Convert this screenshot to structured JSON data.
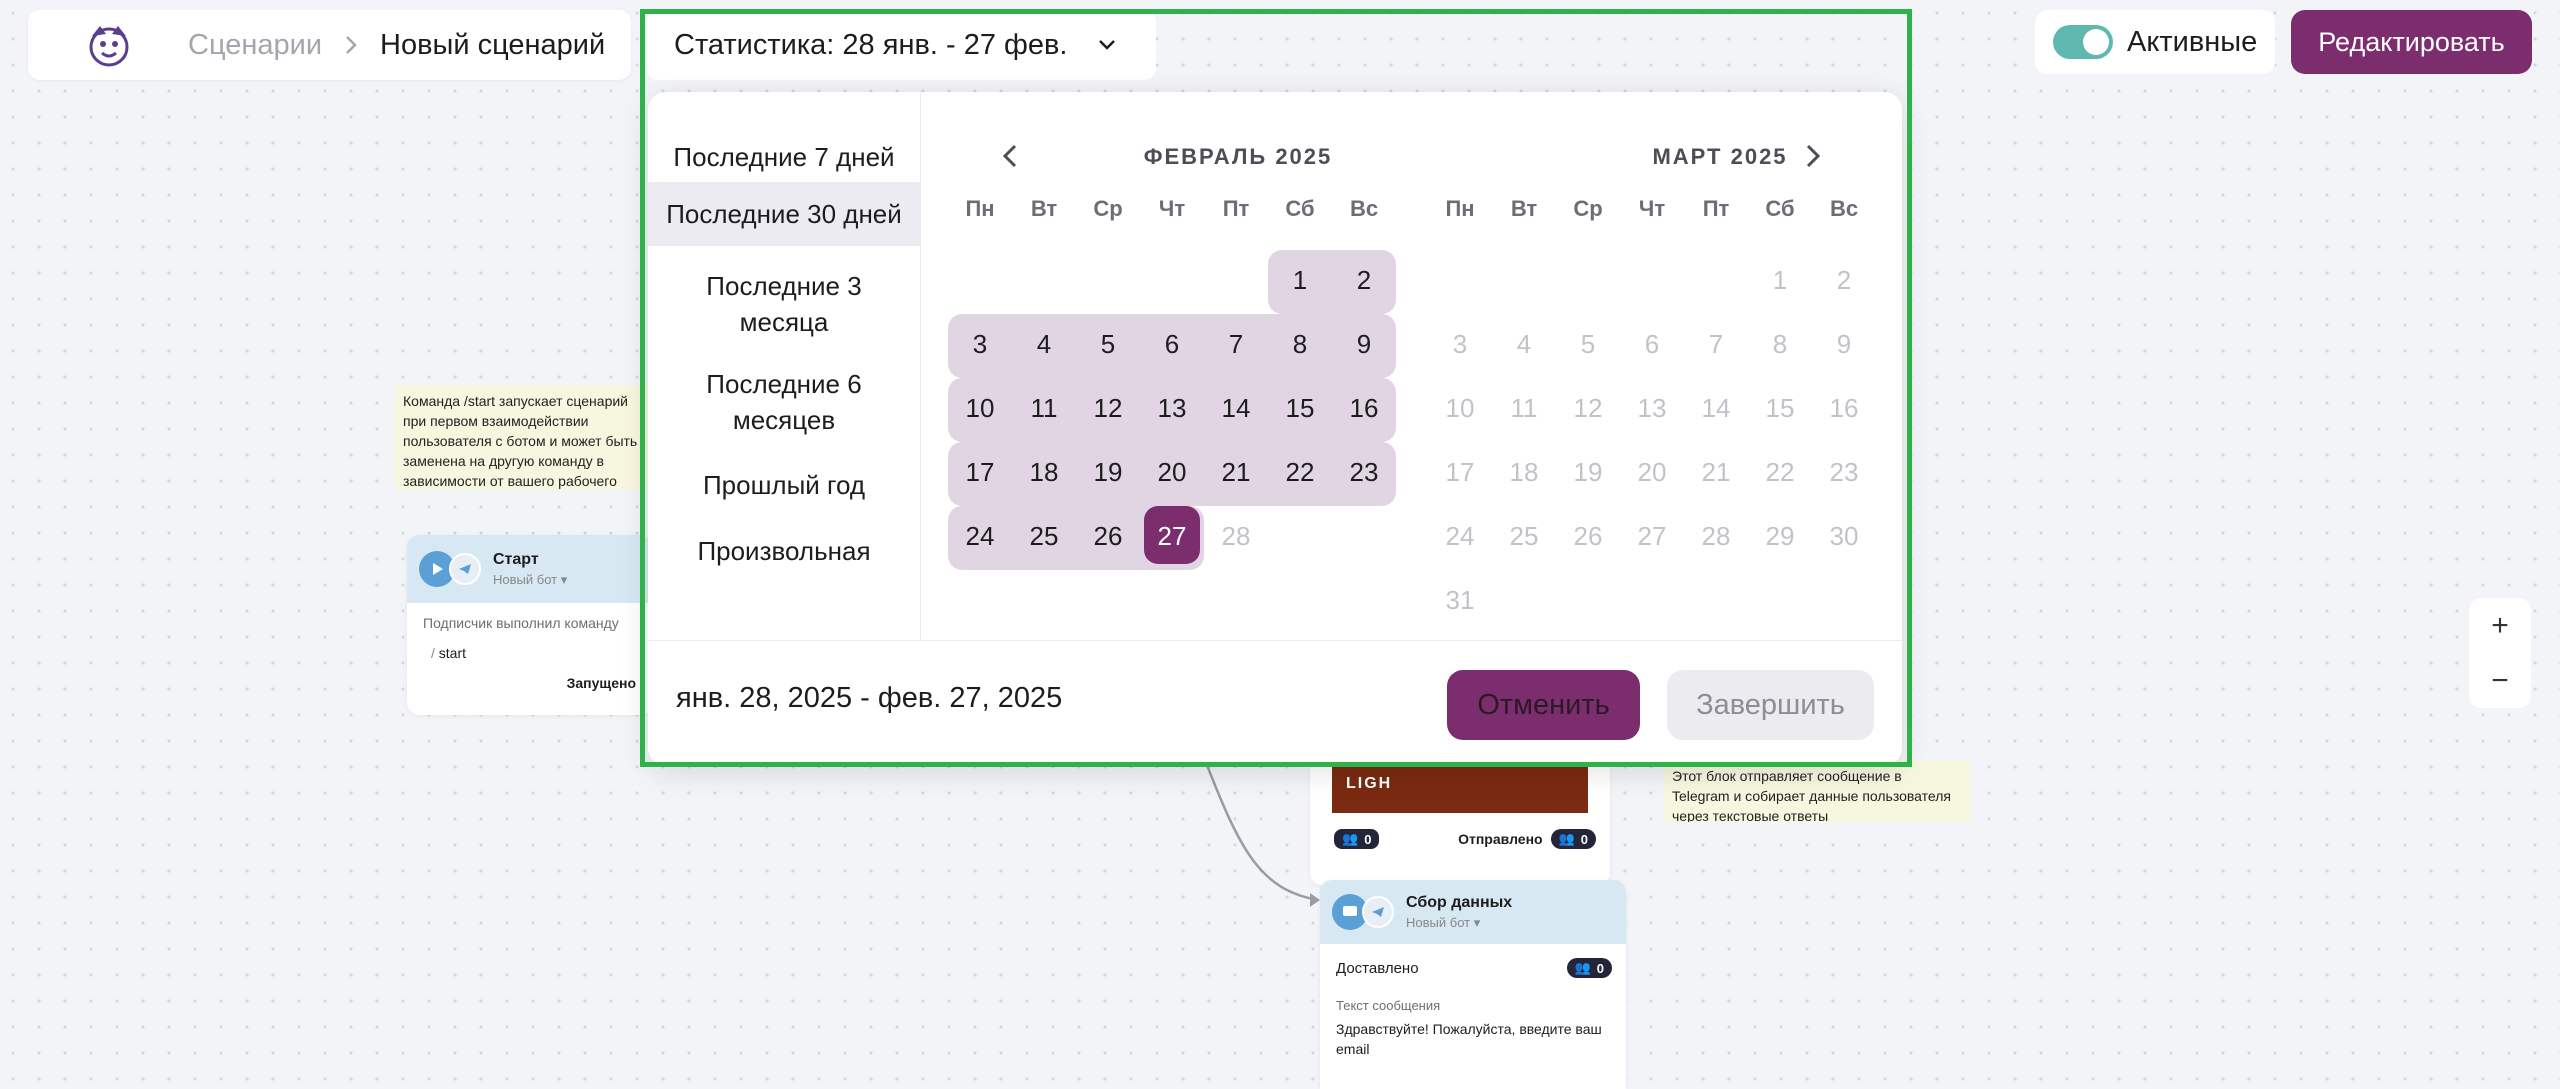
{
  "header": {
    "breadcrumb_parent": "Сценарии",
    "breadcrumb_current": "Новый сценарий",
    "stats_label": "Статистика: 28 янв. - 27 фев.",
    "active_toggle_label": "Активные",
    "edit_button": "Редактировать"
  },
  "zoom": {
    "in": "+",
    "out": "−"
  },
  "canvas": {
    "note_start": "Команда /start запускает сценарий при первом взаимодействии пользователя с ботом и может быть заменена на другую команду в зависимости от вашего рабочего процесса",
    "note_collect": "Этот блок отправляет сообщение в Telegram и собирает данные пользователя через текстовые ответы",
    "start_node": {
      "title": "Старт",
      "subtitle": "Новый бот",
      "trigger_label": "Подписчик выполнил команду",
      "command": "start",
      "status": "Запущено"
    },
    "message_node": {
      "banner_text": "LIGH",
      "count": "0",
      "sent_label": "Отправлено",
      "sent_count": "0"
    },
    "collect_node": {
      "title": "Сбор данных",
      "subtitle": "Новый бот",
      "delivered_label": "Доставлено",
      "delivered_count": "0",
      "message_label": "Текст сообщения",
      "message_text": "Здравствуйте! Пожалуйста, введите ваш email"
    }
  },
  "picker": {
    "presets": [
      "Последние 7 дней",
      "Последние 30 дней",
      "Последние 3\nмесяца",
      "Последние 6\nмесяцев",
      "Прошлый год",
      "Произвольная"
    ],
    "selected_preset_index": 1,
    "weekdays": [
      "Пн",
      "Вт",
      "Ср",
      "Чт",
      "Пт",
      "Сб",
      "Вс"
    ],
    "month_left": {
      "title": "ФЕВРАЛЬ 2025",
      "first_weekday_index": 5,
      "days_in_month": 28,
      "range_end": 27,
      "selected_day": 27
    },
    "month_right": {
      "title": "МАРТ 2025",
      "first_weekday_index": 5,
      "days_in_month": 31
    },
    "range_text": "янв. 28, 2025 - фев. 27, 2025",
    "cancel_button": "Отменить",
    "done_button": "Завершить",
    "colors": {
      "accent": "#7c2d6e",
      "range": "#e2d5e3",
      "frame": "#2db34a"
    }
  }
}
